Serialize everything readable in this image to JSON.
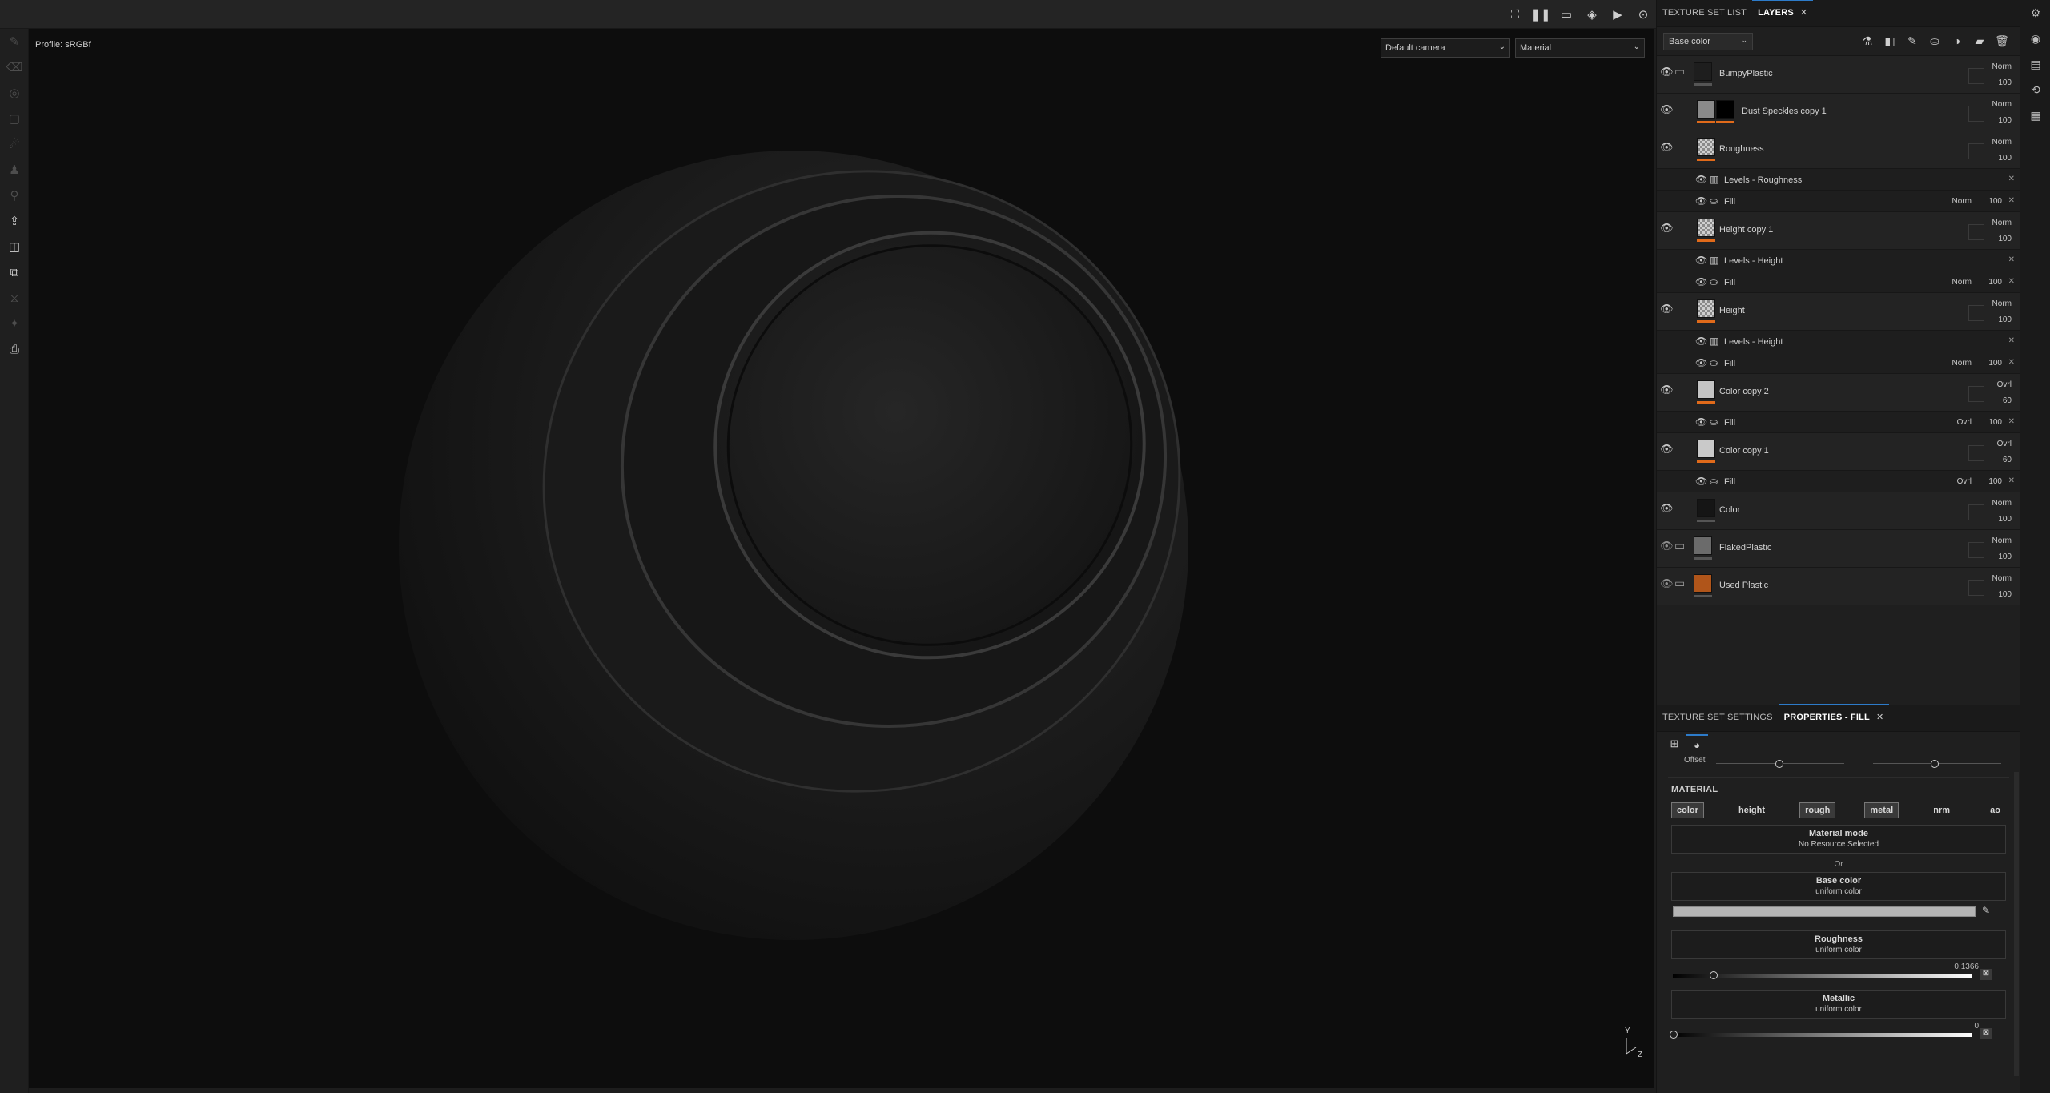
{
  "viewport": {
    "profile": "Profile: sRGBf",
    "camera": "Default camera",
    "display_mode": "Material",
    "axis_y": "Y",
    "axis_z": "Z"
  },
  "panel_tabs": {
    "tab1": "TEXTURE SET LIST",
    "tab2": "LAYERS"
  },
  "layers_toolbar": {
    "channel": "Base color"
  },
  "layers": [
    {
      "name": "BumpyPlastic",
      "blend": "Norm",
      "opacity": "100"
    },
    {
      "name": "Dust Speckles copy 1",
      "blend": "Norm",
      "opacity": "100"
    },
    {
      "name": "Roughness",
      "blend": "Norm",
      "opacity": "100"
    },
    {
      "name": "Levels - Roughness"
    },
    {
      "name": "Fill",
      "blend": "Norm",
      "opacity": "100"
    },
    {
      "name": "Height copy 1",
      "blend": "Norm",
      "opacity": "100"
    },
    {
      "name": "Levels - Height"
    },
    {
      "name": "Fill",
      "blend": "Norm",
      "opacity": "100"
    },
    {
      "name": "Height",
      "blend": "Norm",
      "opacity": "100"
    },
    {
      "name": "Levels - Height"
    },
    {
      "name": "Fill",
      "blend": "Norm",
      "opacity": "100"
    },
    {
      "name": "Color copy 2",
      "blend": "Ovrl",
      "opacity": "60"
    },
    {
      "name": "Fill",
      "blend": "Ovrl",
      "opacity": "100"
    },
    {
      "name": "Color copy 1",
      "blend": "Ovrl",
      "opacity": "60"
    },
    {
      "name": "Fill",
      "blend": "Ovrl",
      "opacity": "100"
    },
    {
      "name": "Color",
      "blend": "Norm",
      "opacity": "100"
    },
    {
      "name": "FlakedPlastic",
      "blend": "Norm",
      "opacity": "100"
    },
    {
      "name": "Used Plastic",
      "blend": "Norm",
      "opacity": "100"
    }
  ],
  "props_tabs": {
    "tab1": "TEXTURE SET SETTINGS",
    "tab2": "PROPERTIES - FILL"
  },
  "props": {
    "offset_label": "Offset",
    "material_title": "MATERIAL",
    "channels": [
      "color",
      "height",
      "rough",
      "metal",
      "nrm",
      "ao"
    ],
    "material_mode": "Material mode",
    "material_mode_value": "No Resource Selected",
    "or": "Or",
    "base_color": "Base color",
    "base_color_sub": "uniform color",
    "roughness": "Roughness",
    "roughness_sub": "uniform color",
    "roughness_value": "0.1366",
    "metallic": "Metallic",
    "metallic_sub": "uniform color",
    "metallic_value": "0"
  },
  "colors": {
    "accent_orange": "#e06a1a",
    "active_tab": "#2d7bc9"
  }
}
